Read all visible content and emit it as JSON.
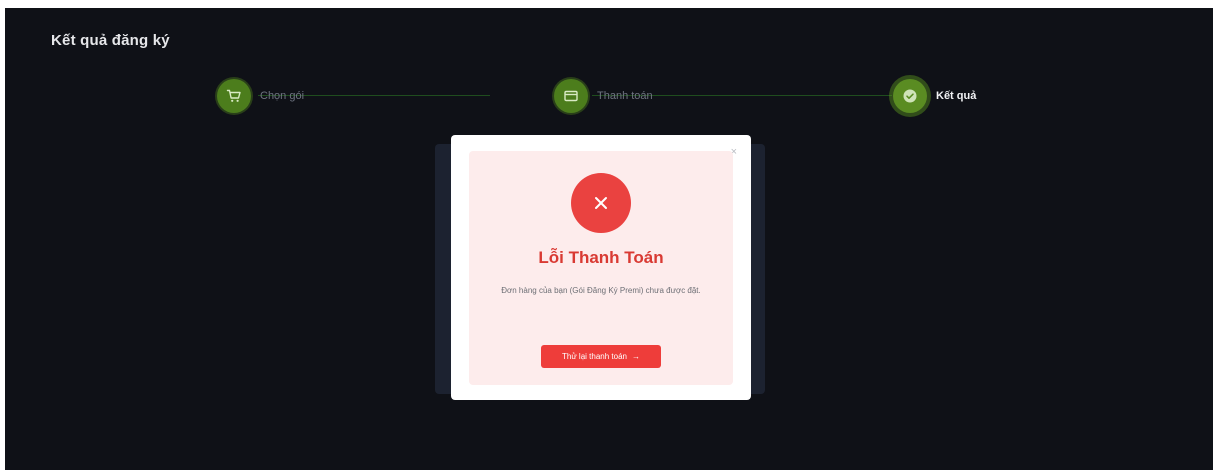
{
  "page": {
    "title": "Kết quả đăng ký"
  },
  "stepper": {
    "steps": [
      {
        "label": "Chọn gói",
        "icon": "cart-icon",
        "state": "completed"
      },
      {
        "label": "Thanh toán",
        "icon": "payment-card-icon",
        "state": "completed"
      },
      {
        "label": "Kết quả",
        "icon": "check-circle-icon",
        "state": "current"
      }
    ]
  },
  "modal": {
    "icon": "close-x-icon",
    "title": "Lỗi Thanh Toán",
    "message": "Đơn hàng của bạn (Gói Đăng Ký Premi) chưa được đặt.",
    "retry_label": "Thử lại thanh toán",
    "retry_arrow": "→",
    "close_glyph": "×"
  },
  "colors": {
    "background": "#0f1117",
    "step_green": "#4c7d1c",
    "error_red": "#ea4240",
    "error_panel": "#fdecec"
  }
}
